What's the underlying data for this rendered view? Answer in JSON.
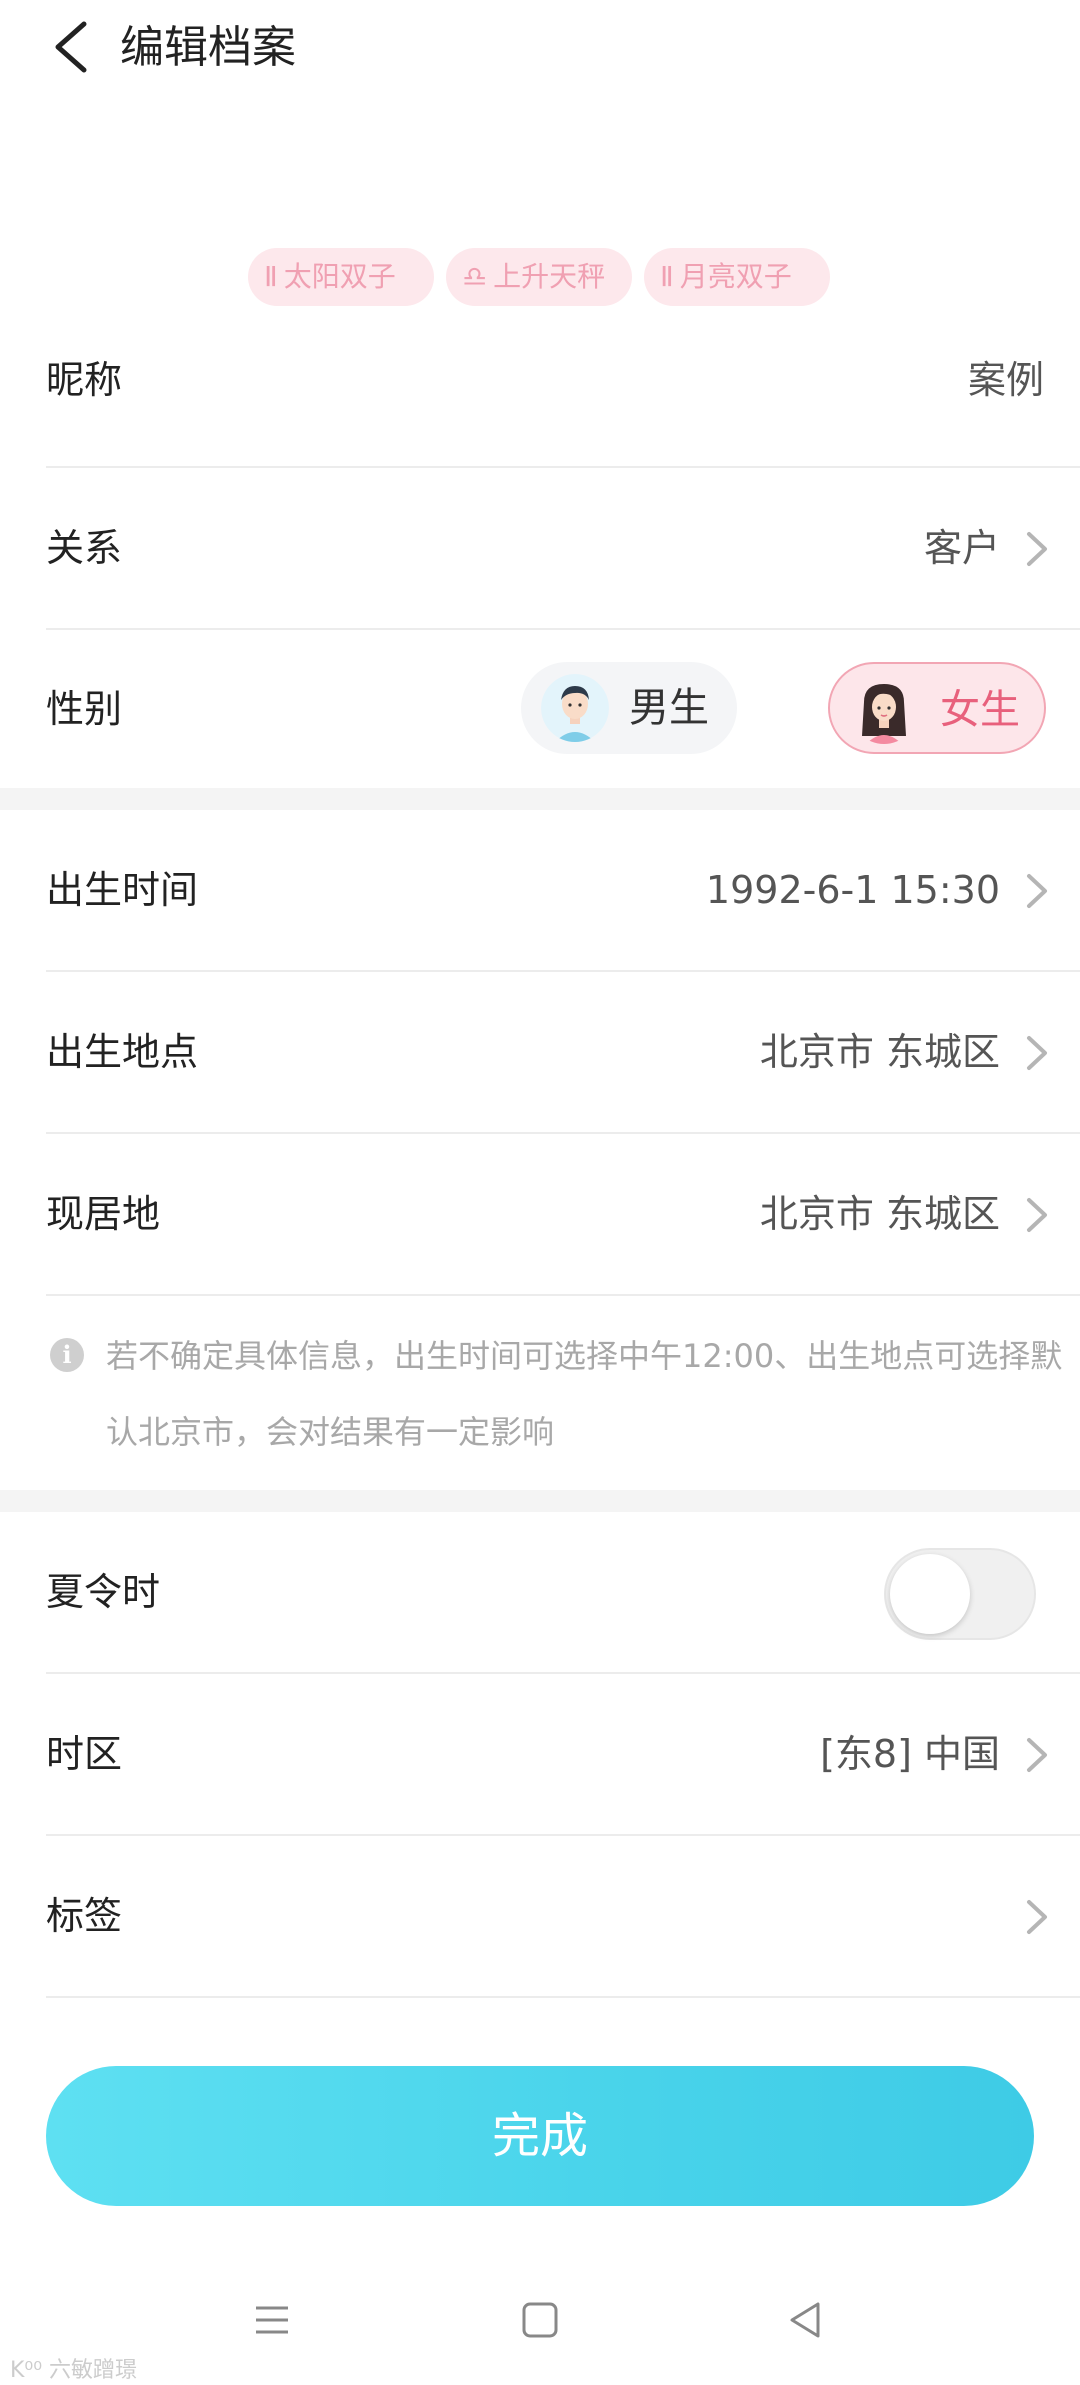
{
  "header": {
    "title": "编辑档案",
    "back_icon": "chevron-left-icon"
  },
  "astro_tags": [
    {
      "glyph": "Ⅱ",
      "label": "太阳双子"
    },
    {
      "glyph": "♎",
      "label": "上升天秤"
    },
    {
      "glyph": "Ⅱ",
      "label": "月亮双子"
    }
  ],
  "profile": {
    "nickname": {
      "label": "昵称",
      "value": "案例"
    },
    "relation": {
      "label": "关系",
      "value": "客户"
    },
    "gender": {
      "label": "性别",
      "male": "男生",
      "female": "女生",
      "selected": "女生"
    }
  },
  "birth": {
    "time": {
      "label": "出生时间",
      "value": "1992-6-1 15:30"
    },
    "place": {
      "label": "出生地点",
      "value": "北京市 东城区"
    },
    "residence": {
      "label": "现居地",
      "value": "北京市 东城区"
    }
  },
  "notice": {
    "icon": "info-icon",
    "text": "若不确定具体信息，出生时间可选择中午12:00、出生地点可选择默认北京市，会对结果有一定影响"
  },
  "settings": {
    "dst": {
      "label": "夏令时",
      "enabled": false
    },
    "timezone": {
      "label": "时区",
      "value": "[东8] 中国"
    },
    "tags": {
      "label": "标签"
    }
  },
  "actions": {
    "done_label": "完成"
  },
  "navbar": {
    "items": [
      "menu-icon",
      "home-square-icon",
      "back-triangle-icon"
    ]
  },
  "watermark": "K⁰⁰ 六敏蹭璟",
  "colors": {
    "accent": "#4fd6ec",
    "female_pink": "#e8607c",
    "tag_bg": "#fde8ec"
  }
}
